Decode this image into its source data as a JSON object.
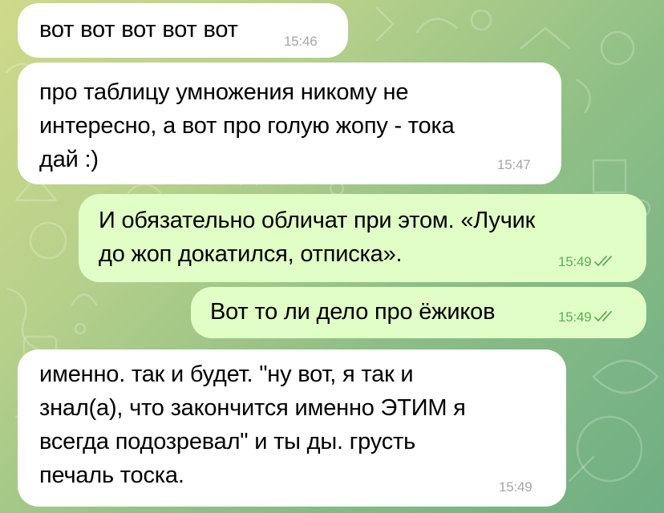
{
  "chat": {
    "colors": {
      "incoming_bubble": "#ffffff",
      "outgoing_bubble": "#e1fec6",
      "incoming_time": "#a6a6a6",
      "outgoing_time": "#5dae5a"
    },
    "messages": [
      {
        "direction": "incoming",
        "text": "вот вот вот вот вот",
        "time": "15:46"
      },
      {
        "direction": "incoming",
        "text": "про таблицу умножения никому не\nинтересно, а вот про голую жопу - тока\nдай :)",
        "time": "15:47"
      },
      {
        "direction": "outgoing",
        "text": "И обязательно обличат при этом. «Лучик\nдо жоп докатился, отписка».",
        "time": "15:49",
        "status_icon": "double-check-icon"
      },
      {
        "direction": "outgoing",
        "text": "Вот то ли дело про ёжиков",
        "time": "15:49",
        "status_icon": "double-check-icon"
      },
      {
        "direction": "incoming",
        "text": "именно. так и будет. \"ну вот, я так и\nзнал(а), что закончится именно ЭТИМ я\nвсегда подозревал\" и ты ды. грусть\nпечаль тоска.",
        "time": "15:49"
      }
    ]
  }
}
